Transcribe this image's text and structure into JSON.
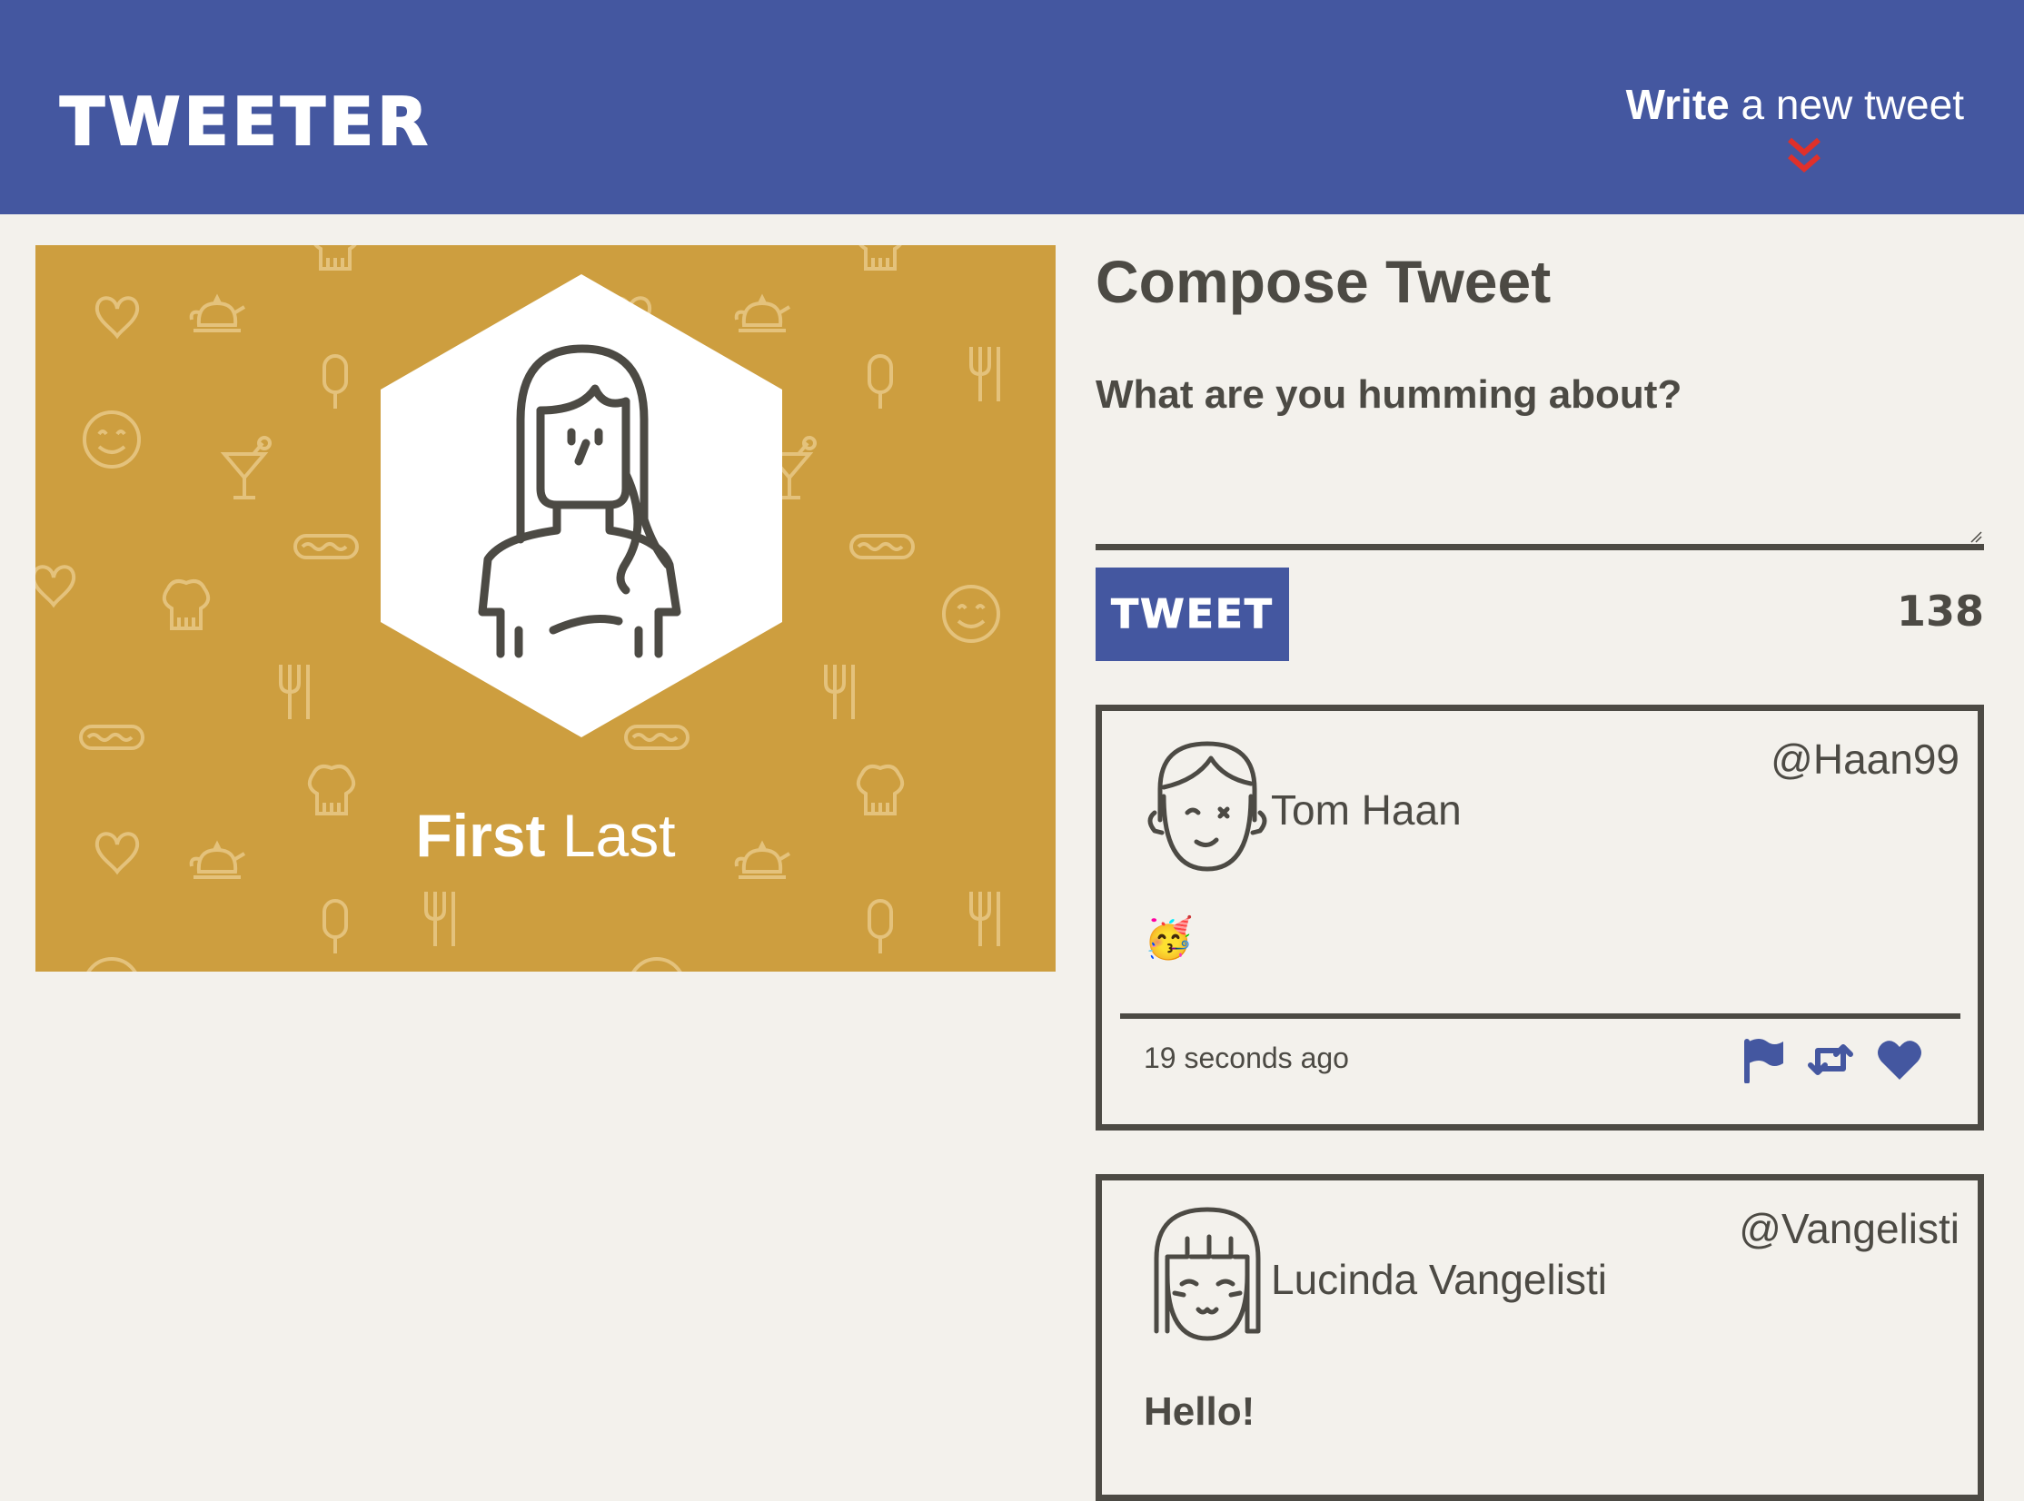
{
  "header": {
    "logo": "TWEETER",
    "write_bold": "Write",
    "write_rest": " a new tweet"
  },
  "profile": {
    "first_name": "First",
    "last_name": "Last"
  },
  "compose": {
    "title": "Compose Tweet",
    "prompt": "What are you humming about?",
    "textarea_value": "",
    "button_label": "TWEET",
    "counter": "138"
  },
  "tweets": [
    {
      "name": "Tom Haan",
      "handle": "@Haan99",
      "content": "🥳",
      "time": "19 seconds ago"
    },
    {
      "name": "Lucinda Vangelisti",
      "handle": "@Vangelisti",
      "content": "Hello!"
    }
  ],
  "colors": {
    "header_bg": "#4457a0",
    "accent_red": "#e0302a",
    "profile_bg": "#cd9e3f",
    "page_bg": "#f3f1ec",
    "text": "#4c4a44"
  },
  "icons": [
    "double-chevron-down-icon",
    "flag-icon",
    "retweet-icon",
    "heart-icon"
  ]
}
